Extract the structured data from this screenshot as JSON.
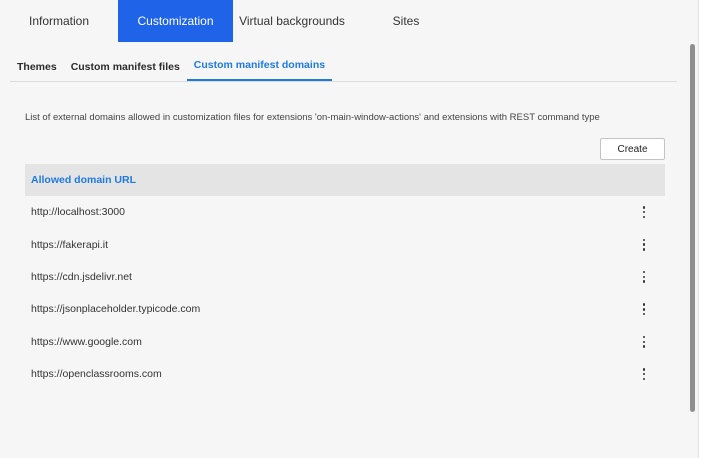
{
  "top_tabs": [
    {
      "label": "Information"
    },
    {
      "label": "Customization"
    },
    {
      "label": "Virtual backgrounds"
    },
    {
      "label": "Sites"
    }
  ],
  "active_top_tab": "Customization",
  "sub_tabs": [
    {
      "label": "Themes"
    },
    {
      "label": "Custom manifest files"
    },
    {
      "label": "Custom manifest domains"
    }
  ],
  "active_sub_tab": "Custom manifest domains",
  "description": "List of external domains allowed in customization files for extensions 'on-main-window-actions' and extensions with REST command type",
  "create_label": "Create",
  "table": {
    "header": "Allowed domain URL",
    "rows": [
      {
        "url": "http://localhost:3000"
      },
      {
        "url": "https://fakerapi.it"
      },
      {
        "url": "https://cdn.jsdelivr.net"
      },
      {
        "url": "https://jsonplaceholder.typicode.com"
      },
      {
        "url": "https://www.google.com"
      },
      {
        "url": "https://openclassrooms.com"
      }
    ]
  },
  "colors": {
    "accent": "#1f63e9",
    "link_blue": "#1f7ae0",
    "header_bg": "#e4e4e4",
    "page_bg": "#f6f6f6"
  },
  "icons": {
    "row_menu": "more-vertical-icon"
  }
}
